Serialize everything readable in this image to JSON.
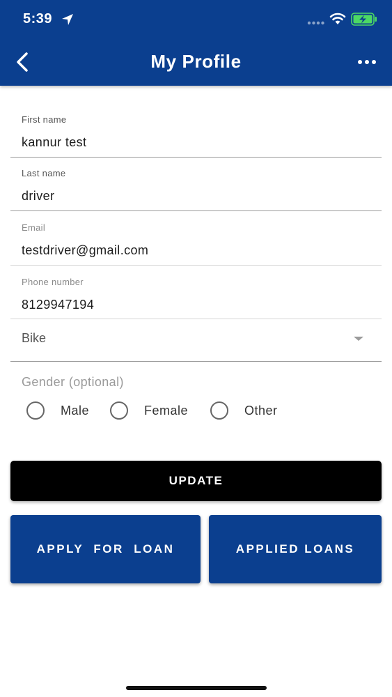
{
  "status_bar": {
    "time": "5:39"
  },
  "header": {
    "title": "My Profile",
    "back_icon": "chevron-left-icon",
    "more_icon": "more-horizontal-icon"
  },
  "form": {
    "first_name": {
      "label": "First name",
      "value": "kannur test"
    },
    "last_name": {
      "label": "Last name",
      "value": "driver"
    },
    "email": {
      "label": "Email",
      "value": "testdriver@gmail.com"
    },
    "phone": {
      "label": "Phone number",
      "value": "8129947194"
    },
    "vehicle": {
      "value": "Bike"
    },
    "gender": {
      "label": "Gender (optional)",
      "options": [
        "Male",
        "Female",
        "Other"
      ]
    }
  },
  "buttons": {
    "update": "UPDATE",
    "apply_loan": "APPLY  FOR  LOAN",
    "applied_loans": "APPLIED LOANS"
  },
  "colors": {
    "primary": "#0b3f8f",
    "update_button": "#000000"
  }
}
